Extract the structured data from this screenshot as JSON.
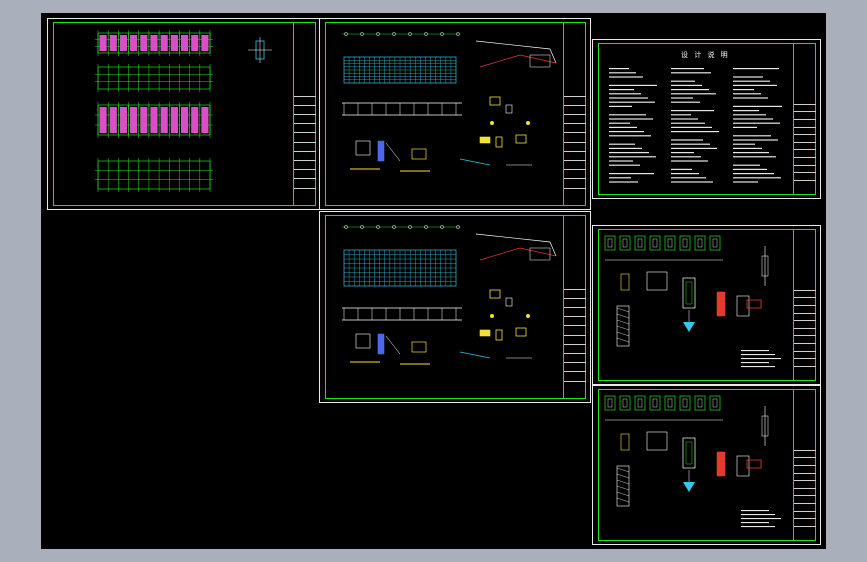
{
  "window": {
    "canvas_background": "#000000",
    "frame_background": "#aab0bb"
  },
  "colors": {
    "sheet_border": "#e8e8e8",
    "frame_line": "#1ee21e",
    "grid_line": "#1ee21e",
    "column_fill": "#d94fc8",
    "dimension_line": "#ffffff",
    "accent_yellow": "#f4e03a",
    "accent_red": "#e23a2e",
    "accent_cyan": "#33c8e8",
    "accent_blue": "#4a6ae8"
  },
  "sheets": [
    {
      "id": "sheet-foundation-plan",
      "kind": "plan",
      "label": ""
    },
    {
      "id": "sheet-roof-elevation-a",
      "kind": "elevation",
      "label": ""
    },
    {
      "id": "sheet-roof-elevation-b",
      "kind": "elevation",
      "label": ""
    },
    {
      "id": "sheet-design-notes",
      "kind": "notes",
      "label": "设 计 说 明"
    },
    {
      "id": "sheet-details-a",
      "kind": "details",
      "label": ""
    },
    {
      "id": "sheet-details-b",
      "kind": "details",
      "label": ""
    }
  ]
}
